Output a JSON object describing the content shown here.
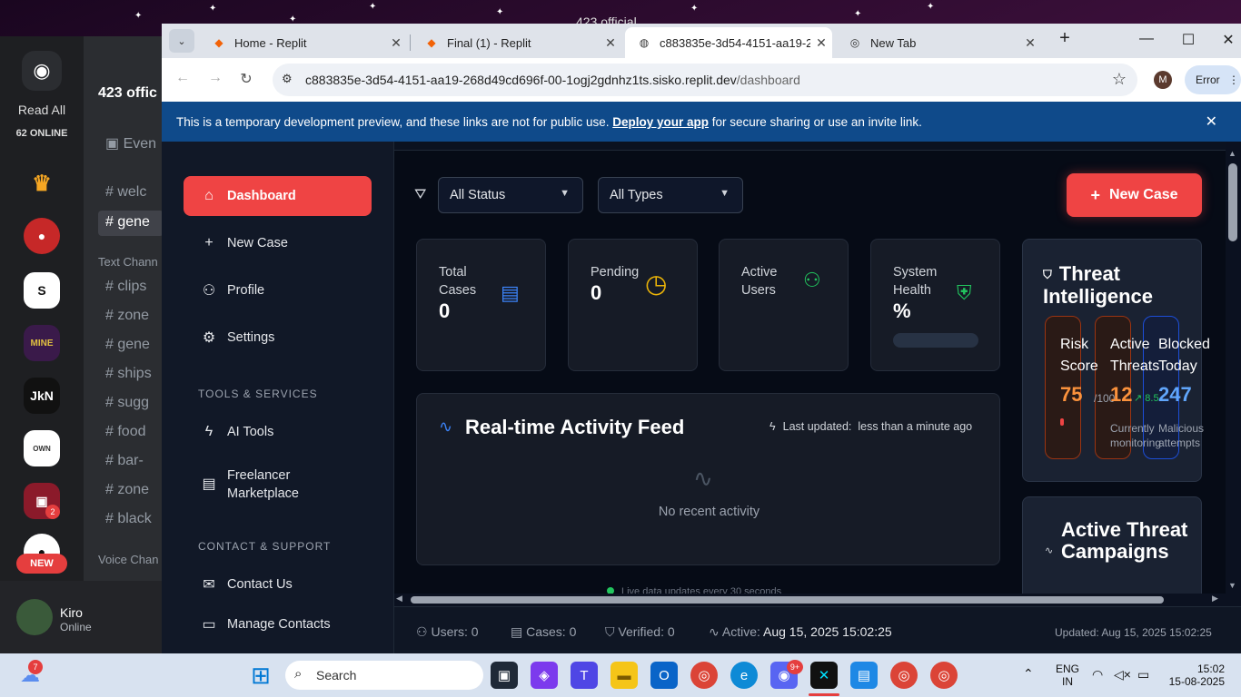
{
  "discord": {
    "window_title": "423 official",
    "read_all": "Read All",
    "online_count": "62 ONLINE",
    "new_pill": "NEW",
    "server_badge": "2",
    "guild_name": "423 offic",
    "channels_top": [
      "Even",
      "welc",
      "gene"
    ],
    "text_category": "Text Chann",
    "text_channels": [
      "clips",
      "zone",
      "gene",
      "ships",
      "sugg",
      "food",
      "bar-",
      "zone",
      "black"
    ],
    "voice_category": "Voice Chan",
    "user_name": "Kiro",
    "user_status": "Online",
    "server_jkn": "JkN"
  },
  "browser": {
    "tabs": [
      {
        "label": "Home - Replit",
        "favicon": "replit-icon"
      },
      {
        "label": "Final (1) - Replit",
        "favicon": "replit-icon"
      },
      {
        "label": "c883835e-3d54-4151-aa19-268d",
        "favicon": "globe-icon"
      },
      {
        "label": "New Tab",
        "favicon": "chrome-icon"
      }
    ],
    "url_host": "c883835e-3d54-4151-aa19-268d49cd696f-00-1ogj2gdnhz1ts.sisko.replit.dev",
    "url_path": "/dashboard",
    "profile_initial": "M",
    "error_label": "Error",
    "banner_prefix": "This is a temporary development preview, and these links are not for public use. ",
    "banner_link": "Deploy your app",
    "banner_suffix": " for secure sharing or use an invite link."
  },
  "sidebar": {
    "items": [
      {
        "label": "Dashboard",
        "icon": "home-icon"
      },
      {
        "label": "New Case",
        "icon": "plus-icon"
      },
      {
        "label": "Profile",
        "icon": "users-icon"
      },
      {
        "label": "Settings",
        "icon": "gear-icon"
      }
    ],
    "section_tools": "TOOLS & SERVICES",
    "tools": [
      {
        "label": "AI Tools",
        "icon": "bolt-icon"
      },
      {
        "label": "Freelancer Marketplace",
        "icon": "briefcase-icon"
      }
    ],
    "section_contact": "CONTACT & SUPPORT",
    "contact": [
      {
        "label": "Contact Us",
        "icon": "mail-icon"
      },
      {
        "label": "Manage Contacts",
        "icon": "chat-icon"
      }
    ]
  },
  "filters": {
    "status": "All Status",
    "types": "All Types",
    "new_case": "New Case"
  },
  "stats": [
    {
      "label": "Total Cases",
      "value": "0",
      "icon": "document-icon",
      "color": "#3b82f6"
    },
    {
      "label": "Pending",
      "value": "0",
      "icon": "clock-icon",
      "color": "#eab308"
    },
    {
      "label": "Active Users",
      "value": "",
      "icon": "users-icon",
      "color": "#22c55e"
    },
    {
      "label": "System Health",
      "value": "%",
      "icon": "shield-icon",
      "color": "#22c55e"
    }
  ],
  "threat": {
    "title": "Threat Intelligence",
    "risk_label": "Risk Score",
    "risk_value": "75",
    "risk_suffix": "/100",
    "active_label": "Active Threats",
    "active_value": "12",
    "active_trend": "8.5",
    "active_sub": "Currently monitoring",
    "blocked_label": "Blocked Today",
    "blocked_value": "247",
    "blocked_sub": "Malicious attempts"
  },
  "campaigns": {
    "title": "Active Threat Campaigns"
  },
  "feed": {
    "title": "Real-time Activity Feed",
    "last_updated_label": "Last updated:",
    "last_updated_value": "less than a minute ago",
    "empty": "No recent activity",
    "live_note": "Live data updates every 30 seconds"
  },
  "statusbar": {
    "users": "Users: 0",
    "cases": "Cases: 0",
    "verified": "Verified: 0",
    "active_label": "Active:",
    "active_time": "Aug 15, 2025 15:02:25",
    "updated": "Updated: Aug 15, 2025 15:02:25"
  },
  "taskbar": {
    "search": "Search",
    "weather_badge": "7",
    "lang": "ENG",
    "region": "IN",
    "time": "15:02",
    "date": "15-08-2025",
    "discord_badge": "9+"
  }
}
